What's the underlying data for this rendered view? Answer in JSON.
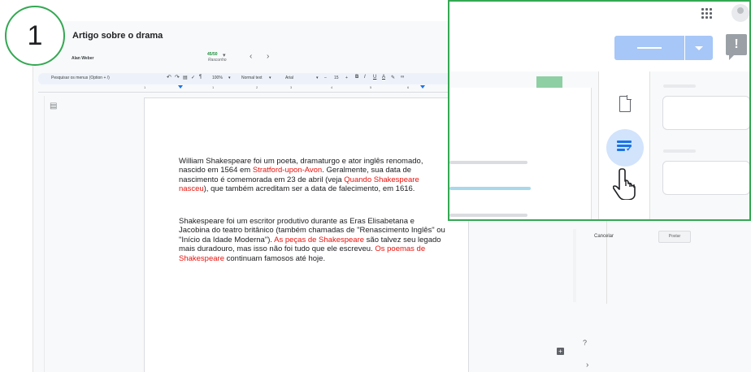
{
  "step": {
    "number": "1"
  },
  "document": {
    "title": "Artigo sobre o drama",
    "author": "Alan Weber",
    "word_count": "45/50",
    "status": "Rascunho",
    "nav_prev": "‹",
    "nav_next": "›"
  },
  "toolbar": {
    "search_menus": "Pesquisar os menus (Option + /)",
    "zoom": "100%",
    "style": "Normal text",
    "font": "Arial",
    "font_size": "15",
    "minus": "–",
    "plus": "+",
    "bold": "B",
    "italic": "I",
    "underline": "U",
    "text_color": "A"
  },
  "ruler": {
    "marks": [
      "1",
      "1",
      "2",
      "3",
      "4",
      "5",
      "6"
    ]
  },
  "body": {
    "p1": {
      "t1": "William Shakespeare foi um poeta, dramaturgo e ator inglês renomado, nascido em 1564 em ",
      "l1": "Stratford-upon-Avon",
      "t2": ". Geralmente, sua data de nascimento é comemorada em 23 de abril (veja ",
      "l2": "Quando Shakespeare nasceu",
      "t3": "), que também acreditam ser a data de falecimento, em 1616."
    },
    "p2": {
      "t1": "Shakespeare foi um escritor produtivo durante as Eras Elisabetana e Jacobina do teatro britânico (também chamadas de \"Renascimento Inglês\" ou \"Início da Idade Moderna\"). ",
      "l1": "As peças de Shakespeare",
      "t2": " são talvez seu legado mais duradouro, mas isso não foi tudo que ele escreveu. ",
      "l2": "Os poemas de Shakespeare",
      "t3": " continuam famosos até hoje."
    }
  },
  "side_panel": {
    "cancel": "Cancelar",
    "post": "Postar"
  },
  "icons": {
    "outline": "outline-icon",
    "help": "help-icon",
    "expand": "chevron-right-icon",
    "apps": "apps-grid-icon",
    "account": "account-icon",
    "feedback": "feedback-icon",
    "doc": "document-icon",
    "suggest": "suggest-edits-icon",
    "hand": "hand-pointer-icon"
  },
  "colors": {
    "accent": "#34a853",
    "link": "#e8120c",
    "share": "#a6c7f7",
    "suggest_bg": "#d2e3fc",
    "suggest_icon": "#1a73e8"
  }
}
